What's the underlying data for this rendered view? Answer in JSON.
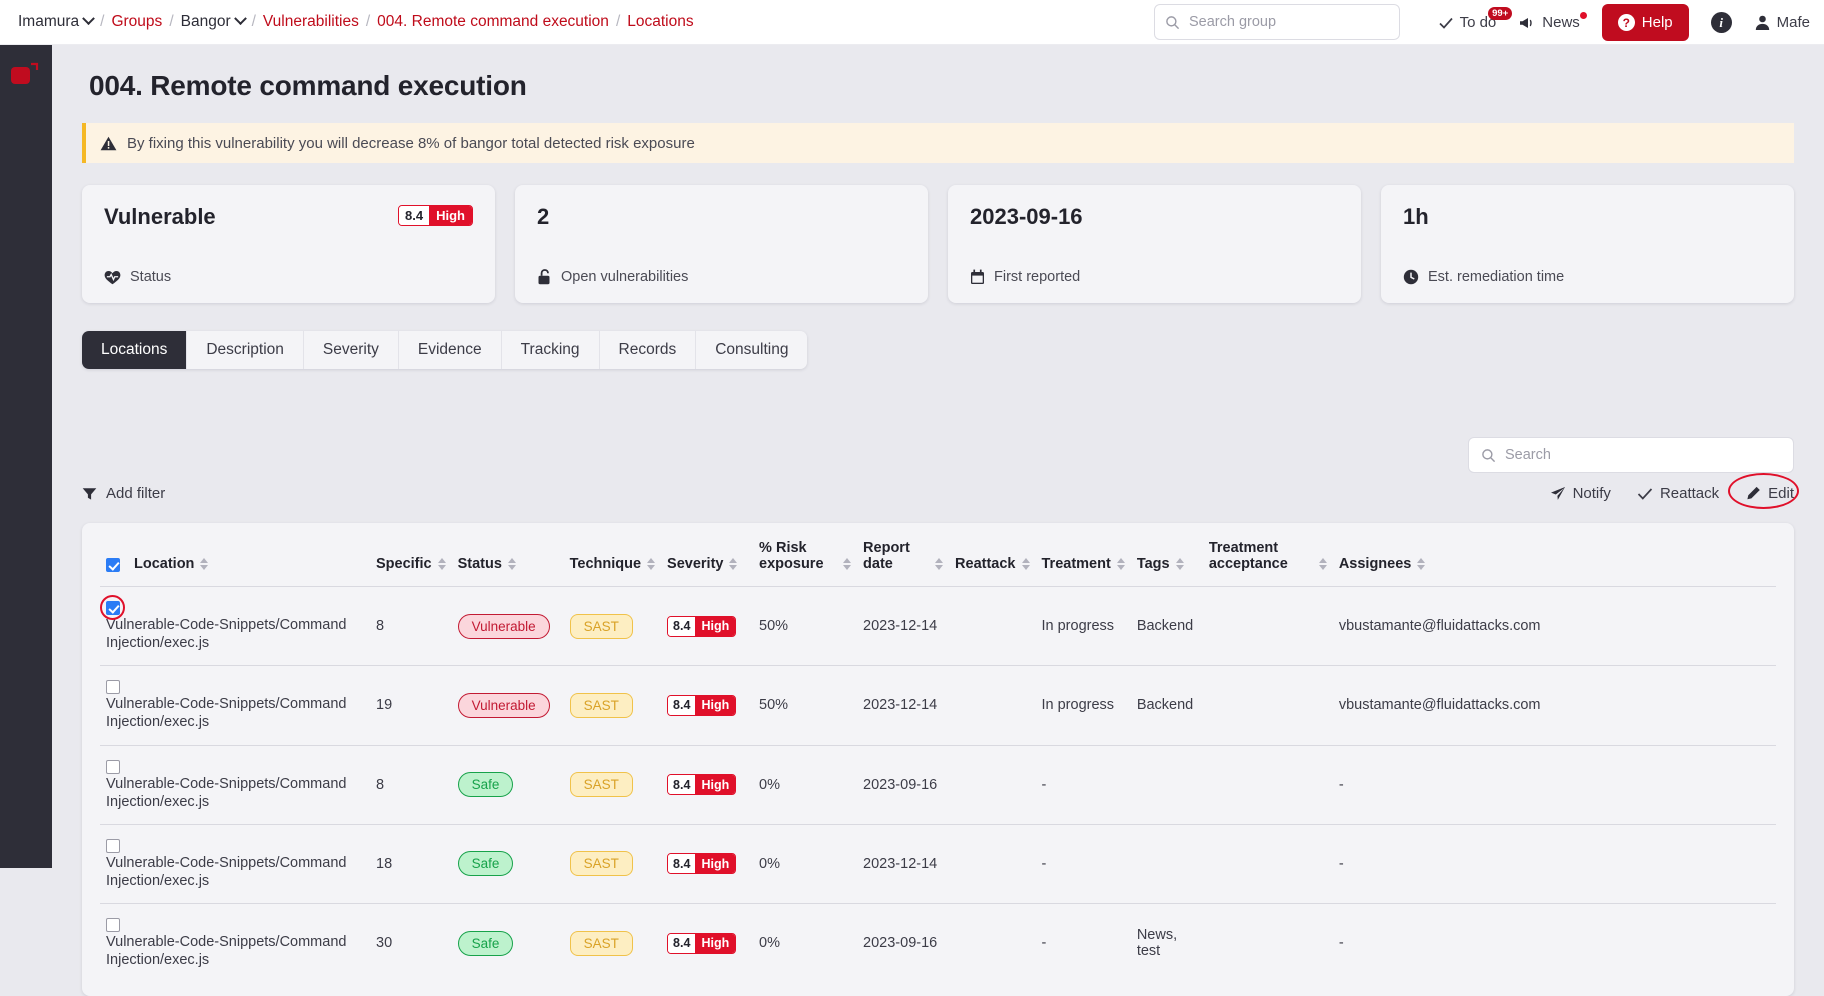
{
  "topbar": {
    "breadcrumb": [
      {
        "label": "Imamura",
        "link": false,
        "caret": true
      },
      {
        "label": "Groups",
        "link": true,
        "caret": false
      },
      {
        "label": "Bangor",
        "link": false,
        "caret": true
      },
      {
        "label": "Vulnerabilities",
        "link": true,
        "caret": false
      },
      {
        "label": "004. Remote command execution",
        "link": true,
        "caret": false
      },
      {
        "label": "Locations",
        "link": true,
        "caret": false
      }
    ],
    "search": {
      "placeholder": "Search group",
      "value": ""
    },
    "todo": {
      "label": "To do",
      "badge": "99+"
    },
    "news": {
      "label": "News"
    },
    "help": {
      "label": "Help"
    },
    "user": {
      "label": "Mafe"
    }
  },
  "page": {
    "title": "004. Remote command execution",
    "alert": "By fixing this vulnerability you will decrease 8% of bangor total detected risk exposure"
  },
  "cards": [
    {
      "value": "Vulnerable",
      "label": "Status",
      "icon": "heart-pulse-icon",
      "severity": {
        "score": "8.4",
        "level": "High"
      }
    },
    {
      "value": "2",
      "label": "Open vulnerabilities",
      "icon": "unlock-icon"
    },
    {
      "value": "2023-09-16",
      "label": "First reported",
      "icon": "calendar-icon"
    },
    {
      "value": "1h",
      "label": "Est. remediation time",
      "icon": "clock-icon"
    }
  ],
  "tabs": [
    {
      "label": "Locations",
      "active": true
    },
    {
      "label": "Description",
      "active": false
    },
    {
      "label": "Severity",
      "active": false
    },
    {
      "label": "Evidence",
      "active": false
    },
    {
      "label": "Tracking",
      "active": false
    },
    {
      "label": "Records",
      "active": false
    },
    {
      "label": "Consulting",
      "active": false
    }
  ],
  "toolbar": {
    "search": {
      "placeholder": "Search",
      "value": ""
    },
    "add_filter": "Add filter",
    "notify": "Notify",
    "reattack": "Reattack",
    "edit": "Edit"
  },
  "table": {
    "headers": [
      "Location",
      "Specific",
      "Status",
      "Technique",
      "Severity",
      "% Risk exposure",
      "Report date",
      "Reattack",
      "Treatment",
      "Tags",
      "Treatment acceptance",
      "Assignees"
    ],
    "header_all_checked": true,
    "rows": [
      {
        "checked": true,
        "highlight": true,
        "location": "Vulnerable-Code-Snippets/Command Injection/exec.js",
        "specific": "8",
        "status": "Vulnerable",
        "technique": "SAST",
        "severity_score": "8.4",
        "severity_level": "High",
        "risk_exposure": "50%",
        "report_date": "2023-12-14",
        "reattack": "",
        "treatment": "In progress",
        "tags": "Backend",
        "treatment_acceptance": "",
        "assignees": "vbustamante@fluidattacks.com"
      },
      {
        "checked": false,
        "highlight": false,
        "location": "Vulnerable-Code-Snippets/Command Injection/exec.js",
        "specific": "19",
        "status": "Vulnerable",
        "technique": "SAST",
        "severity_score": "8.4",
        "severity_level": "High",
        "risk_exposure": "50%",
        "report_date": "2023-12-14",
        "reattack": "",
        "treatment": "In progress",
        "tags": "Backend",
        "treatment_acceptance": "",
        "assignees": "vbustamante@fluidattacks.com"
      },
      {
        "checked": false,
        "highlight": false,
        "location": "Vulnerable-Code-Snippets/Command Injection/exec.js",
        "specific": "8",
        "status": "Safe",
        "technique": "SAST",
        "severity_score": "8.4",
        "severity_level": "High",
        "risk_exposure": "0%",
        "report_date": "2023-09-16",
        "reattack": "",
        "treatment": "-",
        "tags": "",
        "treatment_acceptance": "",
        "assignees": "-"
      },
      {
        "checked": false,
        "highlight": false,
        "location": "Vulnerable-Code-Snippets/Command Injection/exec.js",
        "specific": "18",
        "status": "Safe",
        "technique": "SAST",
        "severity_score": "8.4",
        "severity_level": "High",
        "risk_exposure": "0%",
        "report_date": "2023-12-14",
        "reattack": "",
        "treatment": "-",
        "tags": "",
        "treatment_acceptance": "",
        "assignees": "-"
      },
      {
        "checked": false,
        "highlight": false,
        "location": "Vulnerable-Code-Snippets/Command Injection/exec.js",
        "specific": "30",
        "status": "Safe",
        "technique": "SAST",
        "severity_score": "8.4",
        "severity_level": "High",
        "risk_exposure": "0%",
        "report_date": "2023-09-16",
        "reattack": "",
        "treatment": "-",
        "tags": "News, test",
        "treatment_acceptance": "",
        "assignees": "-"
      }
    ]
  },
  "colors": {
    "brand_red": "#c00c1f",
    "danger": "#e0102a",
    "safe_green": "#17a24a",
    "warn_yellow": "#f5b825",
    "dark": "#2e2e38"
  }
}
